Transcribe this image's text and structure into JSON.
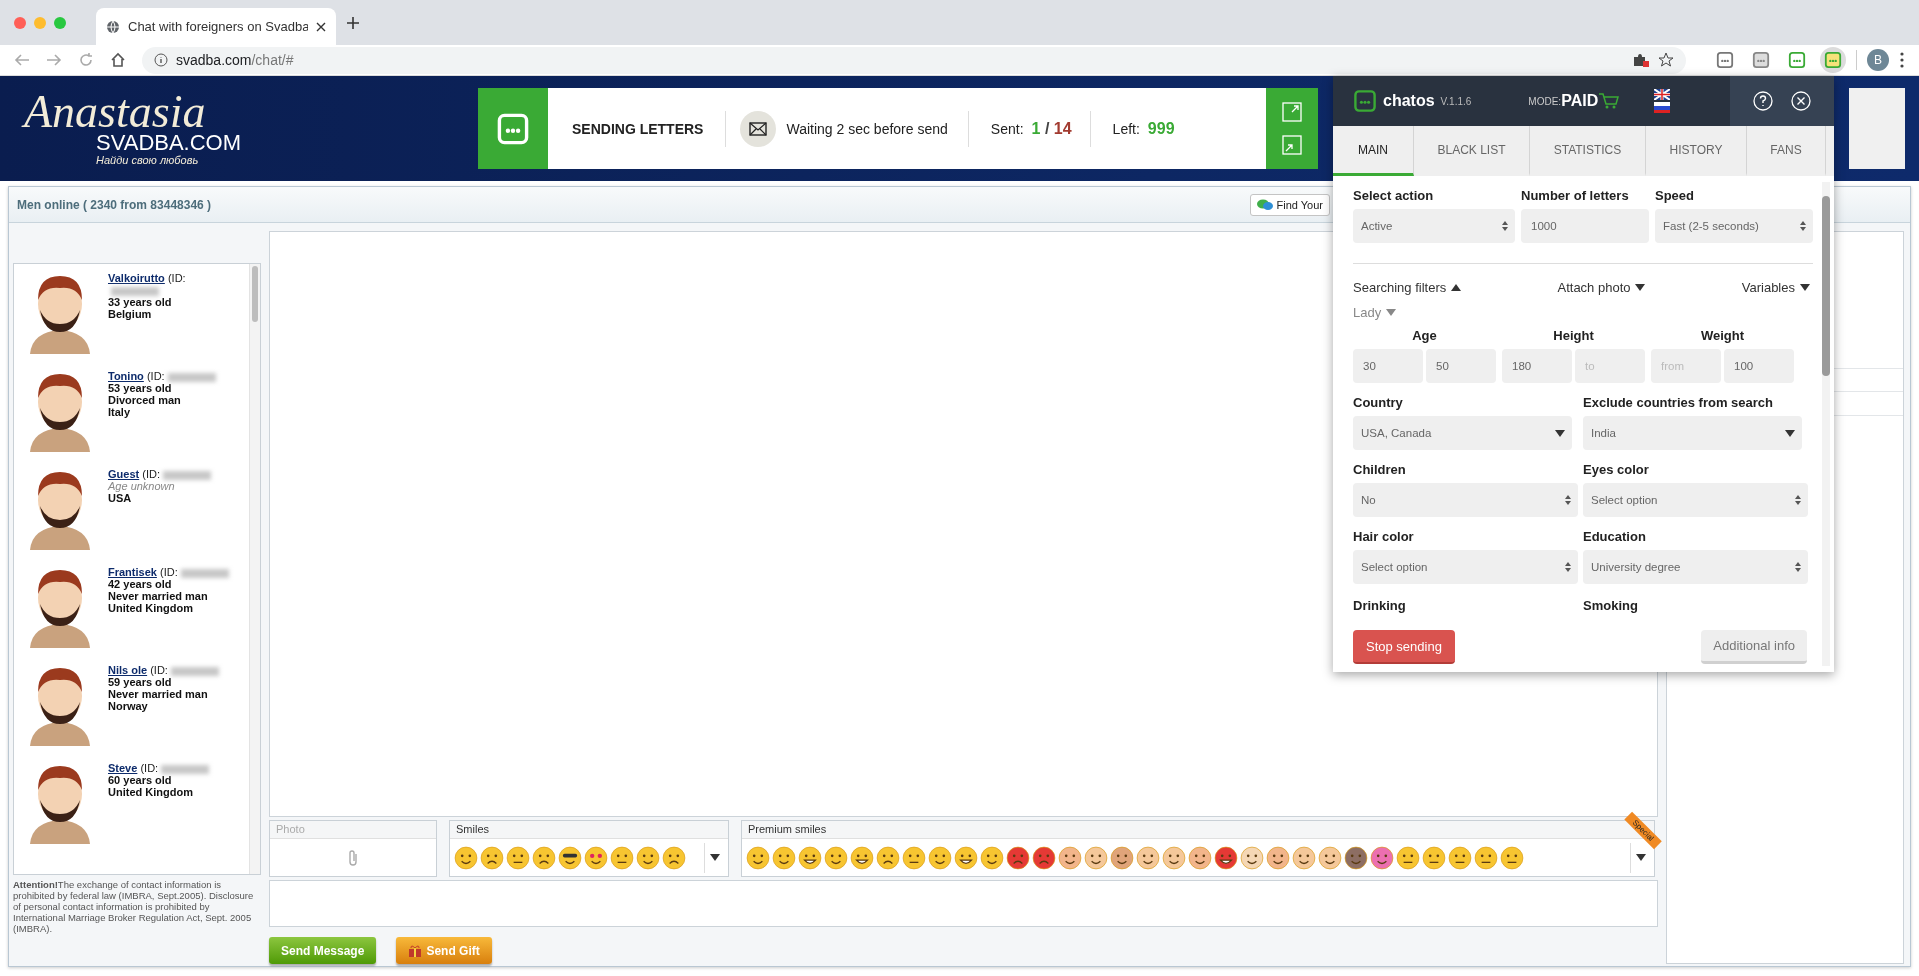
{
  "browser": {
    "tab_title": "Chat with foreigners on Svadba",
    "url_host": "svadba.com",
    "url_path": "/chat/#",
    "profile_initial": "B"
  },
  "site_header": {
    "logo_script": "Anastasia",
    "logo_name": "SVADBA.COM",
    "logo_tagline": "Найди свою любовь"
  },
  "sender": {
    "title": "SENDING LETTERS",
    "status": "Waiting 2 sec before send",
    "sent_label": "Sent:",
    "sent_count": "1",
    "sent_separator": "/",
    "sent_total": "14",
    "left_label": "Left:",
    "left_count": "999"
  },
  "chat": {
    "online_title": "Men online ( 2340 from 83448346 )",
    "find_button": "Find Your",
    "users": [
      {
        "name": "Valkoirutto",
        "id_label": "(ID:",
        "details": [
          {
            "text": "33 years old",
            "kind": "plain"
          },
          {
            "text": "Belgium",
            "kind": "plain"
          }
        ]
      },
      {
        "name": "Tonino",
        "id_label": "(ID:",
        "details": [
          {
            "text": "53 years old",
            "kind": "plain"
          },
          {
            "text": "Divorced man",
            "kind": "plain"
          },
          {
            "text": "Italy",
            "kind": "plain"
          }
        ]
      },
      {
        "name": "Guest",
        "id_label": "(ID:",
        "details": [
          {
            "text": "Age unknown",
            "kind": "muted"
          },
          {
            "text": "USA",
            "kind": "plain"
          }
        ]
      },
      {
        "name": "Frantisek",
        "id_label": "(ID:",
        "details": [
          {
            "text": "42 years old",
            "kind": "plain"
          },
          {
            "text": "Never married man",
            "kind": "plain"
          },
          {
            "text": "United Kingdom",
            "kind": "plain"
          }
        ]
      },
      {
        "name": "Nils ole",
        "id_label": "(ID:",
        "details": [
          {
            "text": "59 years old",
            "kind": "plain"
          },
          {
            "text": "Never married man",
            "kind": "plain"
          },
          {
            "text": "Norway",
            "kind": "plain"
          }
        ]
      },
      {
        "name": "Steve",
        "id_label": "(ID:",
        "details": [
          {
            "text": "60 years old",
            "kind": "plain"
          },
          {
            "text": "United Kingdom",
            "kind": "plain"
          }
        ]
      }
    ],
    "notice": "**Attention!**The exchange of contact information is prohibited by federal law (IMBRA, Sept.2005). Disclosure of personal contact information is prohibited by International Marriage Broker Regulation Act, Sept. 2005 (IMBRA).",
    "photo_label": "Photo",
    "smiles_label": "Smiles",
    "premium_label": "Premium smiles",
    "premium_ribbon": "Special",
    "send_message": "Send Message",
    "send_gift": "Send Gift"
  },
  "extension": {
    "brand": "chatos",
    "version": "V.1.1.6",
    "mode_label": "MODE:",
    "mode_value": "PAID",
    "tabs": [
      {
        "label": "MAIN",
        "selected": true
      },
      {
        "label": "BLACK LIST",
        "selected": false
      },
      {
        "label": "STATISTICS",
        "selected": false
      },
      {
        "label": "HISTORY",
        "selected": false
      },
      {
        "label": "FANS",
        "selected": false
      }
    ],
    "top_fields": [
      {
        "label": "Select action",
        "kind": "select",
        "value": "Active"
      },
      {
        "label": "Number of letters",
        "kind": "input",
        "value": "1000"
      },
      {
        "label": "Speed",
        "kind": "select",
        "value": "Fast (2-5 seconds)"
      }
    ],
    "sections": [
      {
        "label": "Searching filters",
        "expanded": true
      },
      {
        "label": "Attach photo",
        "expanded": false
      },
      {
        "label": "Variables",
        "expanded": false
      }
    ],
    "subsection": {
      "label": "Lady",
      "expanded": false
    },
    "ranges": [
      {
        "label": "Age",
        "from": {
          "value": "30"
        },
        "to": {
          "value": "50"
        }
      },
      {
        "label": "Height",
        "from": {
          "value": "180"
        },
        "to": {
          "placeholder": "to"
        }
      },
      {
        "label": "Weight",
        "from": {
          "placeholder": "from"
        },
        "to": {
          "value": "100"
        }
      }
    ],
    "filters": [
      {
        "label": "Country",
        "kind": "multiselect",
        "value": "USA, Canada"
      },
      {
        "label": "Exclude countries from search",
        "kind": "multiselect",
        "value": "India"
      },
      {
        "label": "Children",
        "kind": "select",
        "value": "No"
      },
      {
        "label": "Eyes color",
        "kind": "select",
        "value": "Select option"
      },
      {
        "label": "Hair color",
        "kind": "select",
        "value": "Select option"
      },
      {
        "label": "Education",
        "kind": "select",
        "value": "University degree"
      },
      {
        "label": "Drinking",
        "kind": "clipped"
      },
      {
        "label": "Smoking",
        "kind": "clipped"
      }
    ],
    "stop_button": "Stop sending",
    "info_button": "Additional info"
  }
}
